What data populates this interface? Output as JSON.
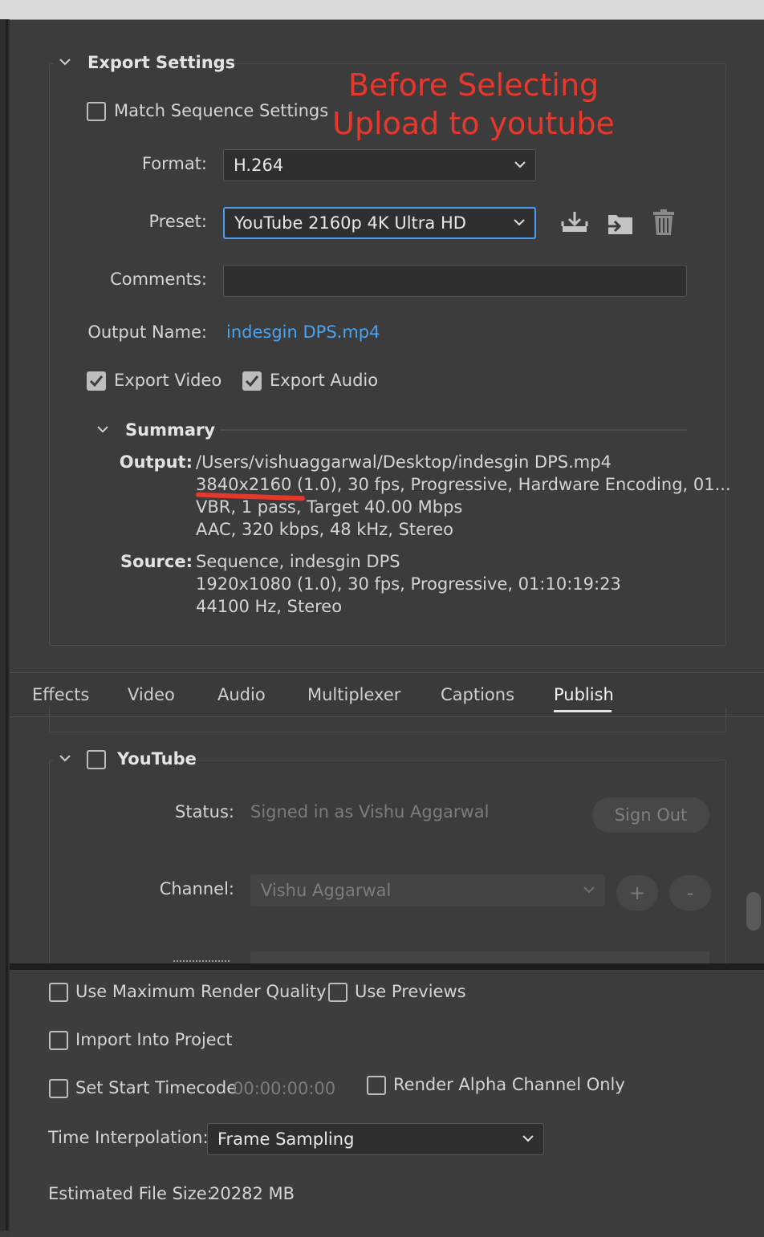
{
  "annotation": {
    "line1": "Before Selecting",
    "line2": "Upload to youtube",
    "color": "#e8372c"
  },
  "export_settings": {
    "title": "Export Settings",
    "match_sequence": {
      "label": "Match Sequence Settings",
      "checked": false
    },
    "format": {
      "label": "Format:",
      "value": "H.264"
    },
    "preset": {
      "label": "Preset:",
      "value": "YouTube 2160p 4K Ultra HD"
    },
    "comments": {
      "label": "Comments:",
      "value": ""
    },
    "output_name": {
      "label": "Output Name:",
      "value": "indesgin DPS.mp4"
    },
    "export_video": {
      "label": "Export Video",
      "checked": true
    },
    "export_audio": {
      "label": "Export Audio",
      "checked": true
    },
    "icons": [
      "save-preset-icon",
      "import-preset-icon",
      "delete-preset-icon"
    ]
  },
  "summary": {
    "title": "Summary",
    "output_key": "Output:",
    "output_lines": [
      "/Users/vishuaggarwal/Desktop/indesgin DPS.mp4",
      "3840x2160 (1.0), 30 fps, Progressive, Hardware Encoding, 01...",
      "VBR, 1 pass, Target 40.00 Mbps",
      "AAC, 320 kbps, 48 kHz, Stereo"
    ],
    "source_key": "Source:",
    "source_lines": [
      "Sequence, indesgin DPS",
      "1920x1080 (1.0), 30 fps, Progressive, 01:10:19:23",
      "44100 Hz, Stereo"
    ]
  },
  "tabs": [
    {
      "label": "Effects",
      "active": false
    },
    {
      "label": "Video",
      "active": false
    },
    {
      "label": "Audio",
      "active": false
    },
    {
      "label": "Multiplexer",
      "active": false
    },
    {
      "label": "Captions",
      "active": false
    },
    {
      "label": "Publish",
      "active": true
    }
  ],
  "youtube": {
    "title": "YouTube",
    "checked": false,
    "status_label": "Status:",
    "status_value": "Signed in as Vishu Aggarwal",
    "sign_out": "Sign Out",
    "channel_label": "Channel:",
    "channel_value": "Vishu Aggarwal",
    "add": "+",
    "remove": "-"
  },
  "bottom": {
    "max_render_quality": {
      "label": "Use Maximum Render Quality",
      "checked": false
    },
    "use_previews": {
      "label": "Use Previews",
      "checked": false
    },
    "import_into_project": {
      "label": "Import Into Project",
      "checked": false
    },
    "set_start_timecode": {
      "label": "Set Start Timecode",
      "checked": false,
      "value": "00:00:00:00"
    },
    "render_alpha": {
      "label": "Render Alpha Channel Only",
      "checked": false
    },
    "time_interpolation": {
      "label": "Time Interpolation:",
      "value": "Frame Sampling"
    },
    "file_size": {
      "label": "Estimated File Size:",
      "value": "20282 MB"
    }
  }
}
